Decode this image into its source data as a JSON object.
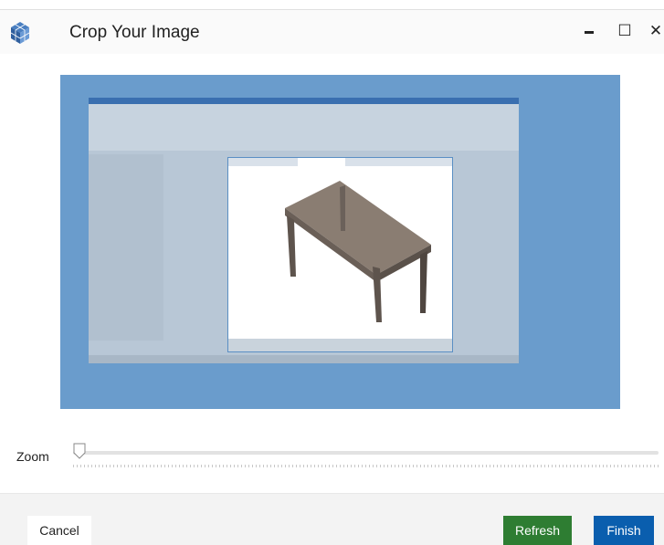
{
  "window": {
    "title": "Crop Your Image",
    "icons": {
      "app": "cube-app-icon",
      "minimize": "minimize-icon",
      "maximize": "maximize-icon",
      "close": "close-icon"
    },
    "glyphs": {
      "minimize": "▬",
      "maximize": "☐",
      "close": "✕"
    }
  },
  "canvas": {
    "overlay_color": "#6a9ccc",
    "crop_selection": "table-3d-view"
  },
  "zoom": {
    "label": "Zoom",
    "value": 0.0
  },
  "footer": {
    "cancel_label": "Cancel",
    "refresh_label": "Refresh",
    "finish_label": "Finish"
  },
  "colors": {
    "refresh": "#2e7d32",
    "finish": "#0a5eae",
    "overlay": "#6a9ccc"
  }
}
